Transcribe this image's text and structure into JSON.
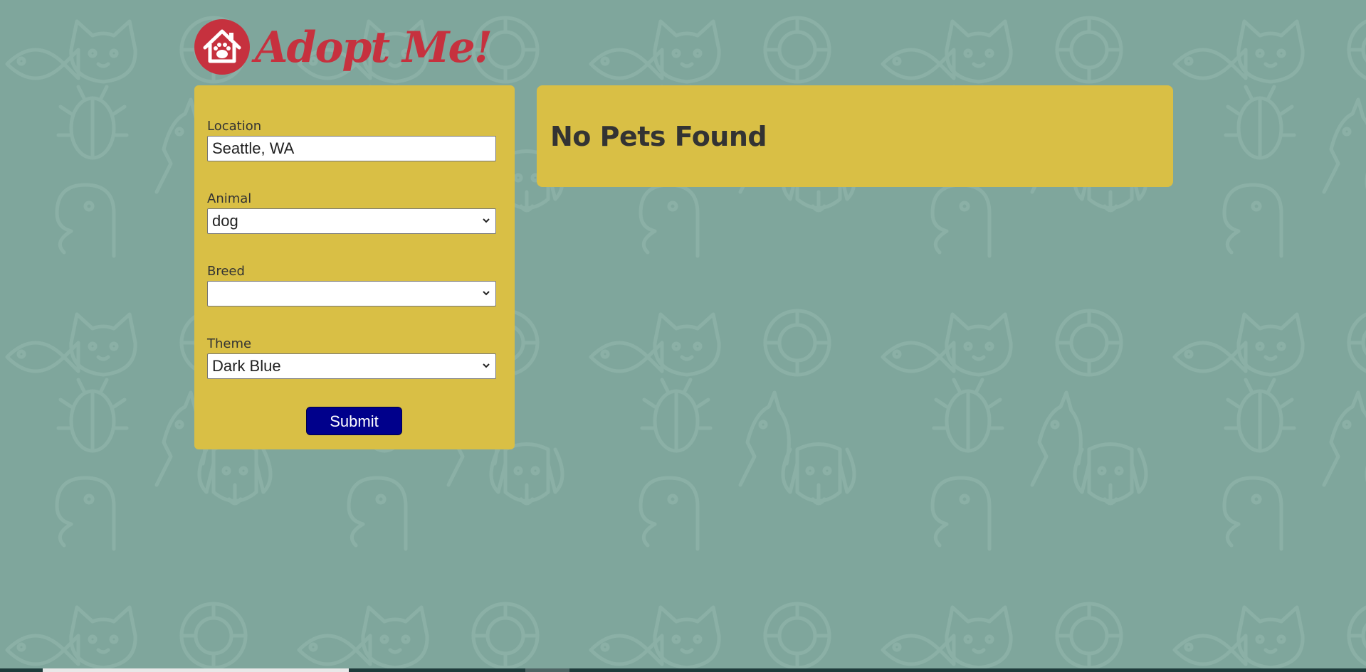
{
  "app": {
    "logo_text": "Adopt Me!"
  },
  "search_form": {
    "location": {
      "label": "Location",
      "value": "Seattle, WA"
    },
    "animal": {
      "label": "Animal",
      "selected": "dog"
    },
    "breed": {
      "label": "Breed",
      "selected": ""
    },
    "theme": {
      "label": "Theme",
      "selected": "Dark Blue"
    },
    "submit_label": "Submit"
  },
  "results": {
    "heading": "No Pets Found"
  },
  "icons": {
    "logo": "house-paw-icon",
    "dropdown": "chevron-down-icon",
    "background": "animal-pattern"
  },
  "colors": {
    "background": "#7fa69c",
    "panel": "#d9bf45",
    "brand": "#c6313e",
    "button": "#00008b",
    "text": "#333333"
  }
}
